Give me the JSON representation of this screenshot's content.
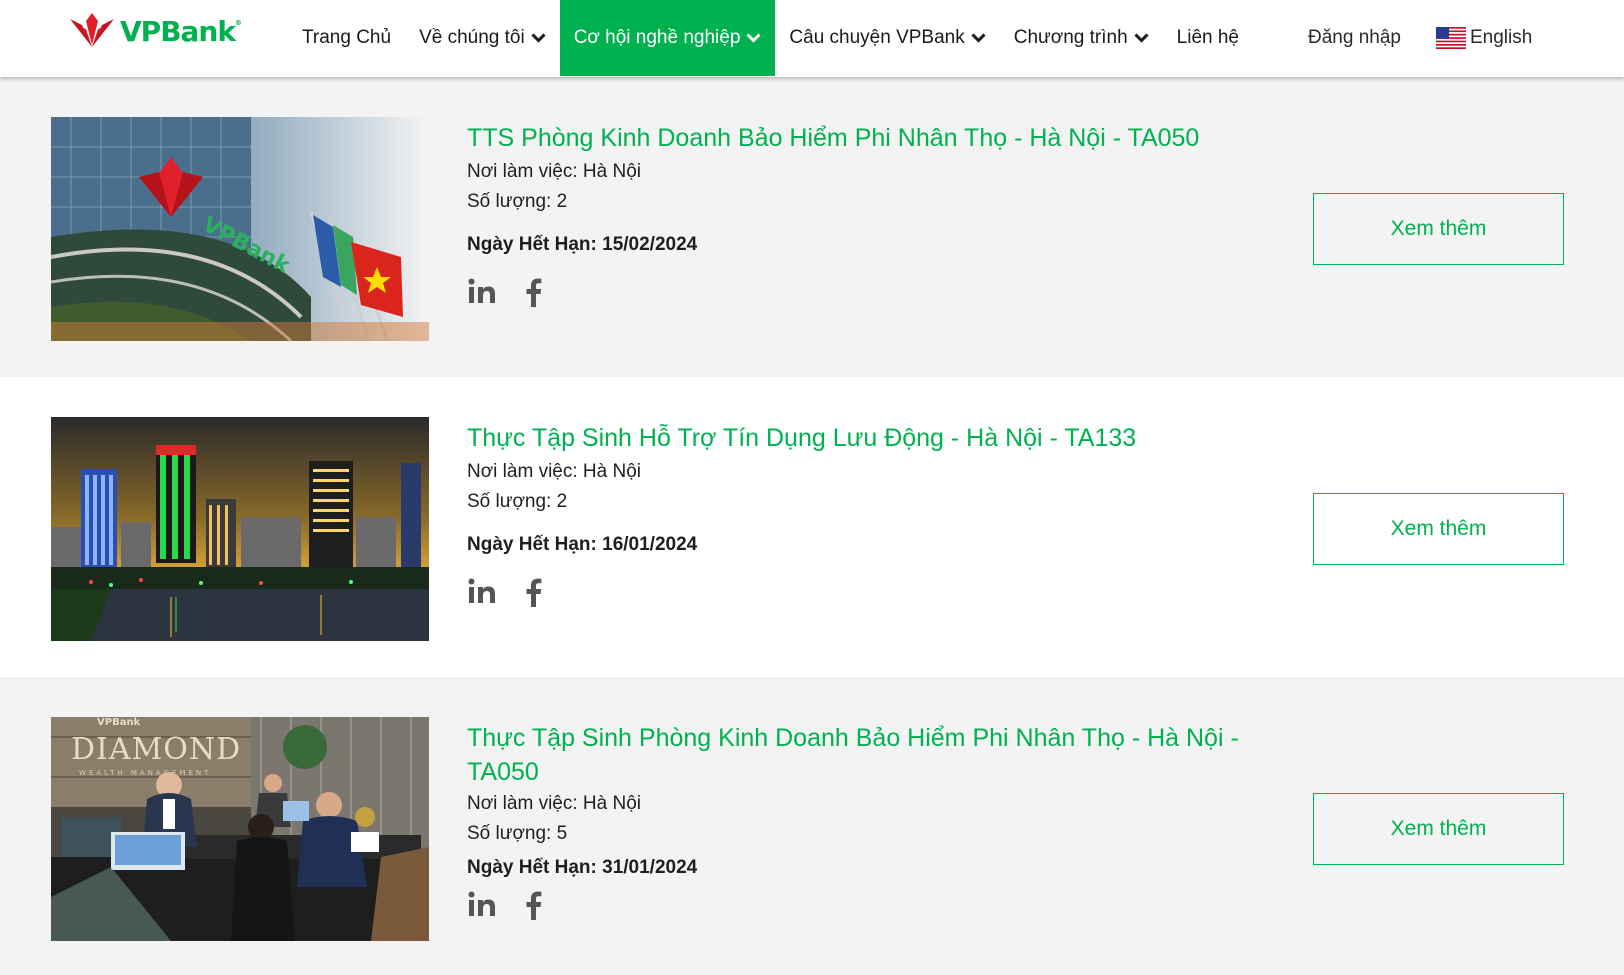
{
  "brand": {
    "name": "VPBank",
    "accent": "#00b14f",
    "logo_red": "#e0202a"
  },
  "nav": {
    "items": [
      {
        "label": "Trang Chủ",
        "dropdown": false
      },
      {
        "label": "Về chúng tôi",
        "dropdown": true
      },
      {
        "label": "Cơ hội nghề nghiệp",
        "dropdown": true,
        "active": true
      },
      {
        "label": "Câu chuyện VPBank",
        "dropdown": true
      },
      {
        "label": "Chương trình",
        "dropdown": true
      },
      {
        "label": "Liên hệ",
        "dropdown": false
      }
    ],
    "login_label": "Đăng nhập",
    "language_label": "English",
    "language_flag": "us-flag-icon"
  },
  "jobs": [
    {
      "title": "TTS Phòng Kinh Doanh Bảo Hiểm Phi Nhân Thọ - Hà Nội - TA050",
      "location": "Nơi làm việc: Hà Nội",
      "quantity": "Số lượng: 2",
      "deadline": "Ngày Hết Hạn: 15/02/2024",
      "button_label": "Xem thêm",
      "image": "vpbank-building-flags-image"
    },
    {
      "title": "Thực Tập Sinh Hỗ Trợ Tín Dụng Lưu Động - Hà Nội - TA133",
      "location": "Nơi làm việc: Hà Nội",
      "quantity": "Số lượng: 2",
      "deadline": "Ngày Hết Hạn: 16/01/2024",
      "button_label": "Xem thêm",
      "image": "hanoi-city-night-image"
    },
    {
      "title": "Thực Tập Sinh Phòng Kinh Doanh Bảo Hiểm Phi Nhân Thọ - Hà Nội - TA050",
      "location": "Nơi làm việc: Hà Nội",
      "quantity": "Số lượng: 5",
      "deadline": "Ngày Hết Hạn: 31/01/2024",
      "button_label": "Xem thêm",
      "image": "diamond-wealth-office-image",
      "image_text": {
        "brand": "VPBank",
        "main": "DIAMOND",
        "sub": "WEALTH MANAGEMENT"
      }
    }
  ],
  "social_icons": [
    "linkedin-icon",
    "facebook-icon"
  ]
}
